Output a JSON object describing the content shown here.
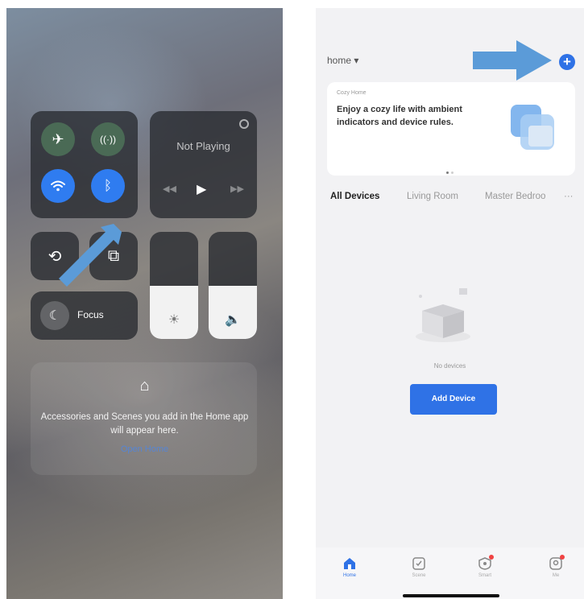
{
  "control_center": {
    "connectivity": {
      "airplane_icon": "airplane-icon",
      "cellular_icon": "cellular-icon",
      "wifi_icon": "wifi-icon",
      "bluetooth_icon": "bluetooth-icon",
      "wifi_color": "#2f7cf0",
      "bluetooth_color": "#2f7cf0"
    },
    "media": {
      "status": "Not Playing"
    },
    "focus": {
      "label": "Focus"
    },
    "brightness_level": 0.5,
    "volume_level": 0.5,
    "home": {
      "message": "Accessories and Scenes you add in the Home app will appear here.",
      "link": "Open Home"
    }
  },
  "app": {
    "home_selector": "home ▾",
    "accent_color": "#2f72e6",
    "banner": {
      "kicker": "Cozy Home",
      "text": "Enjoy a cozy life with ambient indicators and device rules."
    },
    "room_tabs": [
      "All Devices",
      "Living Room",
      "Master Bedroo",
      "···"
    ],
    "empty_message": "No devices",
    "add_device_label": "Add Device",
    "tabbar": [
      {
        "label": "Home",
        "icon": "home-icon"
      },
      {
        "label": "Scene",
        "icon": "scene-icon"
      },
      {
        "label": "Smart",
        "icon": "smart-icon"
      },
      {
        "label": "Me",
        "icon": "me-icon"
      }
    ]
  }
}
